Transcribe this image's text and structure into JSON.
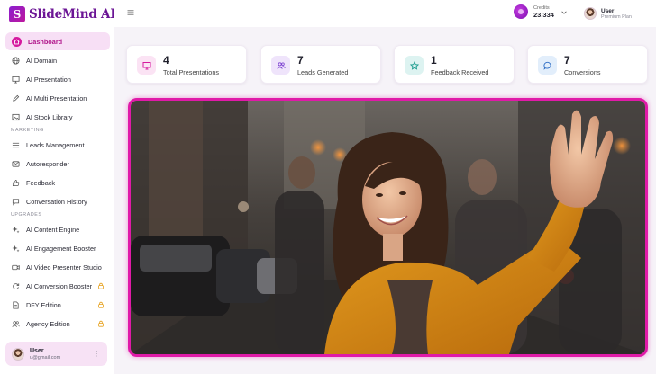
{
  "brand": {
    "logo_letter": "S",
    "name": "SlideMind AI"
  },
  "sidebar": {
    "items_main": [
      {
        "label": "Dashboard",
        "icon": "home-icon",
        "active": true
      },
      {
        "label": "AI Domain",
        "icon": "globe-icon"
      },
      {
        "label": "AI Presentation",
        "icon": "presentation-icon"
      },
      {
        "label": "AI Multi Presentation",
        "icon": "pen-icon"
      },
      {
        "label": "AI Stock Library",
        "icon": "image-icon"
      }
    ],
    "section_marketing": "MARKETING",
    "items_marketing": [
      {
        "label": "Leads Management",
        "icon": "list-icon"
      },
      {
        "label": "Autoresponder",
        "icon": "mail-icon"
      },
      {
        "label": "Feedback",
        "icon": "thumbs-up-icon"
      },
      {
        "label": "Conversation History",
        "icon": "chat-icon"
      }
    ],
    "section_upgrades": "UPGRADES",
    "items_upgrades": [
      {
        "label": "AI Content Engine",
        "icon": "sparkle-icon",
        "locked": false
      },
      {
        "label": "AI Engagement Booster",
        "icon": "sparkle-icon",
        "locked": false
      },
      {
        "label": "AI Video Presenter Studio",
        "icon": "video-icon",
        "locked": false
      },
      {
        "label": "AI Conversion Booster",
        "icon": "refresh-icon",
        "locked": true
      },
      {
        "label": "DFY Edition",
        "icon": "document-icon",
        "locked": true
      },
      {
        "label": "Agency Edition",
        "icon": "users-icon",
        "locked": true
      }
    ],
    "user": {
      "name": "User",
      "email": "u@gmail.com"
    }
  },
  "header": {
    "credits_label": "Credits",
    "credits_value": "23,334",
    "user_name": "User",
    "user_plan": "Premium Plan"
  },
  "stats": [
    {
      "value": "4",
      "label": "Total Presentations",
      "icon": "presentation-icon",
      "bg": "#fbe3f4",
      "fg": "#d5199f"
    },
    {
      "value": "7",
      "label": "Leads Generated",
      "icon": "users-icon",
      "bg": "#efe4fb",
      "fg": "#7b3fd0"
    },
    {
      "value": "1",
      "label": "Feedback Received",
      "icon": "star-icon",
      "bg": "#ddf3f1",
      "fg": "#1a9c8e"
    },
    {
      "value": "7",
      "label": "Conversions",
      "icon": "chat-icon",
      "bg": "#e2eefb",
      "fg": "#2c6cc4"
    }
  ],
  "colors": {
    "accent": "#d5199f",
    "brand": "#6b1595",
    "hero_border": "#e01aa8",
    "lock": "#e6a01a"
  }
}
